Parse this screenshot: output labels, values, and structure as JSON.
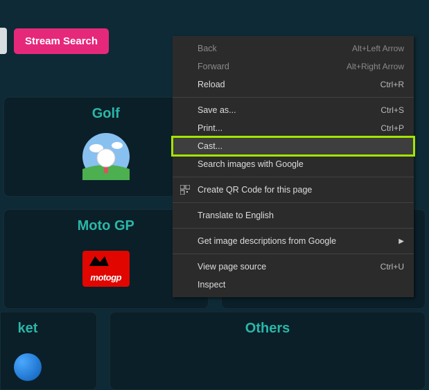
{
  "topbar": {
    "stream_search_label": "Stream Search"
  },
  "cards": {
    "golf": {
      "title": "Golf"
    },
    "motogp": {
      "title": "Moto GP",
      "logo_text": "motogp"
    },
    "cricket_partial": {
      "title": "ket"
    },
    "others": {
      "title": "Others"
    }
  },
  "context_menu": {
    "back": {
      "label": "Back",
      "shortcut": "Alt+Left Arrow"
    },
    "forward": {
      "label": "Forward",
      "shortcut": "Alt+Right Arrow"
    },
    "reload": {
      "label": "Reload",
      "shortcut": "Ctrl+R"
    },
    "save_as": {
      "label": "Save as...",
      "shortcut": "Ctrl+S"
    },
    "print": {
      "label": "Print...",
      "shortcut": "Ctrl+P"
    },
    "cast": {
      "label": "Cast..."
    },
    "search_images": {
      "label": "Search images with Google"
    },
    "qr": {
      "label": "Create QR Code for this page"
    },
    "translate": {
      "label": "Translate to English"
    },
    "img_desc": {
      "label": "Get image descriptions from Google"
    },
    "view_source": {
      "label": "View page source",
      "shortcut": "Ctrl+U"
    },
    "inspect": {
      "label": "Inspect"
    }
  }
}
